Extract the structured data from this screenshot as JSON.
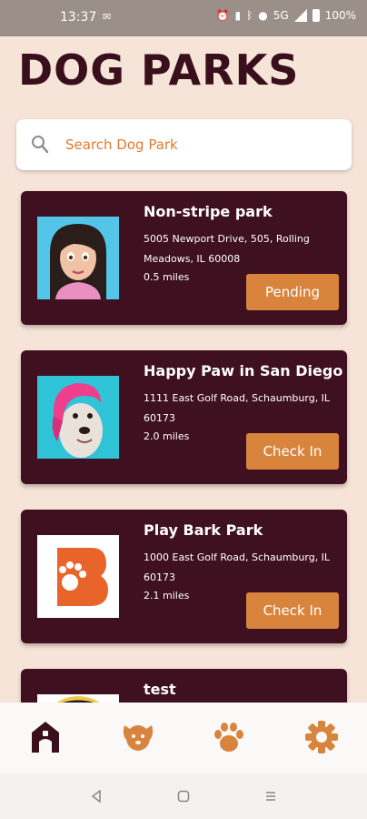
{
  "status_bar": {
    "time": "13:37",
    "network": "5G",
    "battery": "100%"
  },
  "header": {
    "title": "DOG PARKS"
  },
  "search": {
    "placeholder": "Search Dog Park",
    "value": ""
  },
  "parks": [
    {
      "name": "Non-stripe park",
      "address": "5005 Newport Drive, 505, Rolling Meadows, IL 60008",
      "distance": "0.5 miles",
      "action": "Pending"
    },
    {
      "name": "Happy Paw in San Diego",
      "address": "1111 East Golf Road, Schaumburg, IL 60173",
      "distance": "2.0 miles",
      "action": "Check In"
    },
    {
      "name": "Play Bark Park",
      "address": "1000 East Golf Road, Schaumburg, IL 60173",
      "distance": "2.1 miles",
      "action": "Check In"
    },
    {
      "name": "test",
      "address": "",
      "distance": "",
      "action": ""
    }
  ],
  "colors": {
    "background": "#f7e4d8",
    "card": "#3f101f",
    "accent": "#d9843d",
    "title": "#3a0f1c"
  },
  "bottom_nav": {
    "items": [
      "home-icon",
      "dog-face-icon",
      "paw-icon",
      "settings-gear-icon"
    ],
    "active": "home-icon"
  }
}
